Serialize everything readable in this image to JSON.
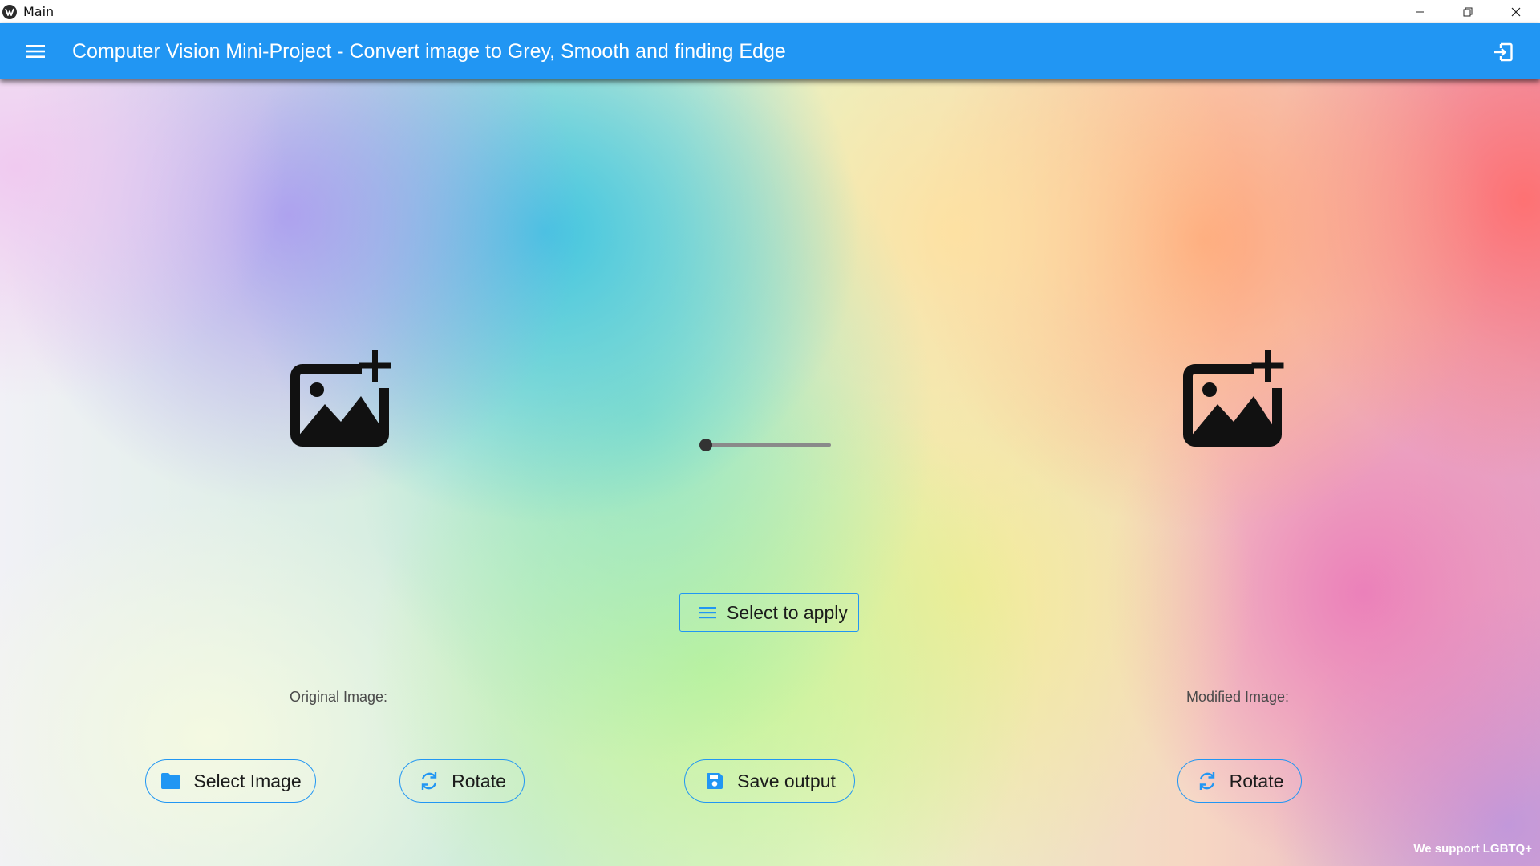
{
  "window": {
    "title": "Main",
    "controls": {
      "minimize": "minimize-icon",
      "restore": "restore-icon",
      "close": "close-icon"
    }
  },
  "appbar": {
    "title": "Computer Vision Mini-Project - Convert image to Grey, Smooth and finding Edge",
    "menu_icon": "menu-icon",
    "exit_icon": "logout-icon",
    "color": "#2196F3"
  },
  "panels": {
    "original": {
      "caption": "Original Image:",
      "placeholder_icon": "add-photo-icon"
    },
    "modified": {
      "caption": "Modified Image:",
      "placeholder_icon": "add-photo-icon"
    }
  },
  "slider": {
    "value": 0,
    "min": 0,
    "max": 100
  },
  "apply_select": {
    "label": "Select to apply",
    "icon": "list-icon"
  },
  "buttons": {
    "select_image": {
      "label": "Select Image",
      "icon": "folder-icon"
    },
    "rotate_original": {
      "label": "Rotate",
      "icon": "rotate-icon"
    },
    "save_output": {
      "label": "Save output",
      "icon": "save-icon"
    },
    "rotate_modified": {
      "label": "Rotate",
      "icon": "rotate-icon"
    }
  },
  "footer": {
    "badge": "We support LGBTQ+"
  },
  "colors": {
    "accent": "#2196F3",
    "icon_dark": "#111111"
  }
}
